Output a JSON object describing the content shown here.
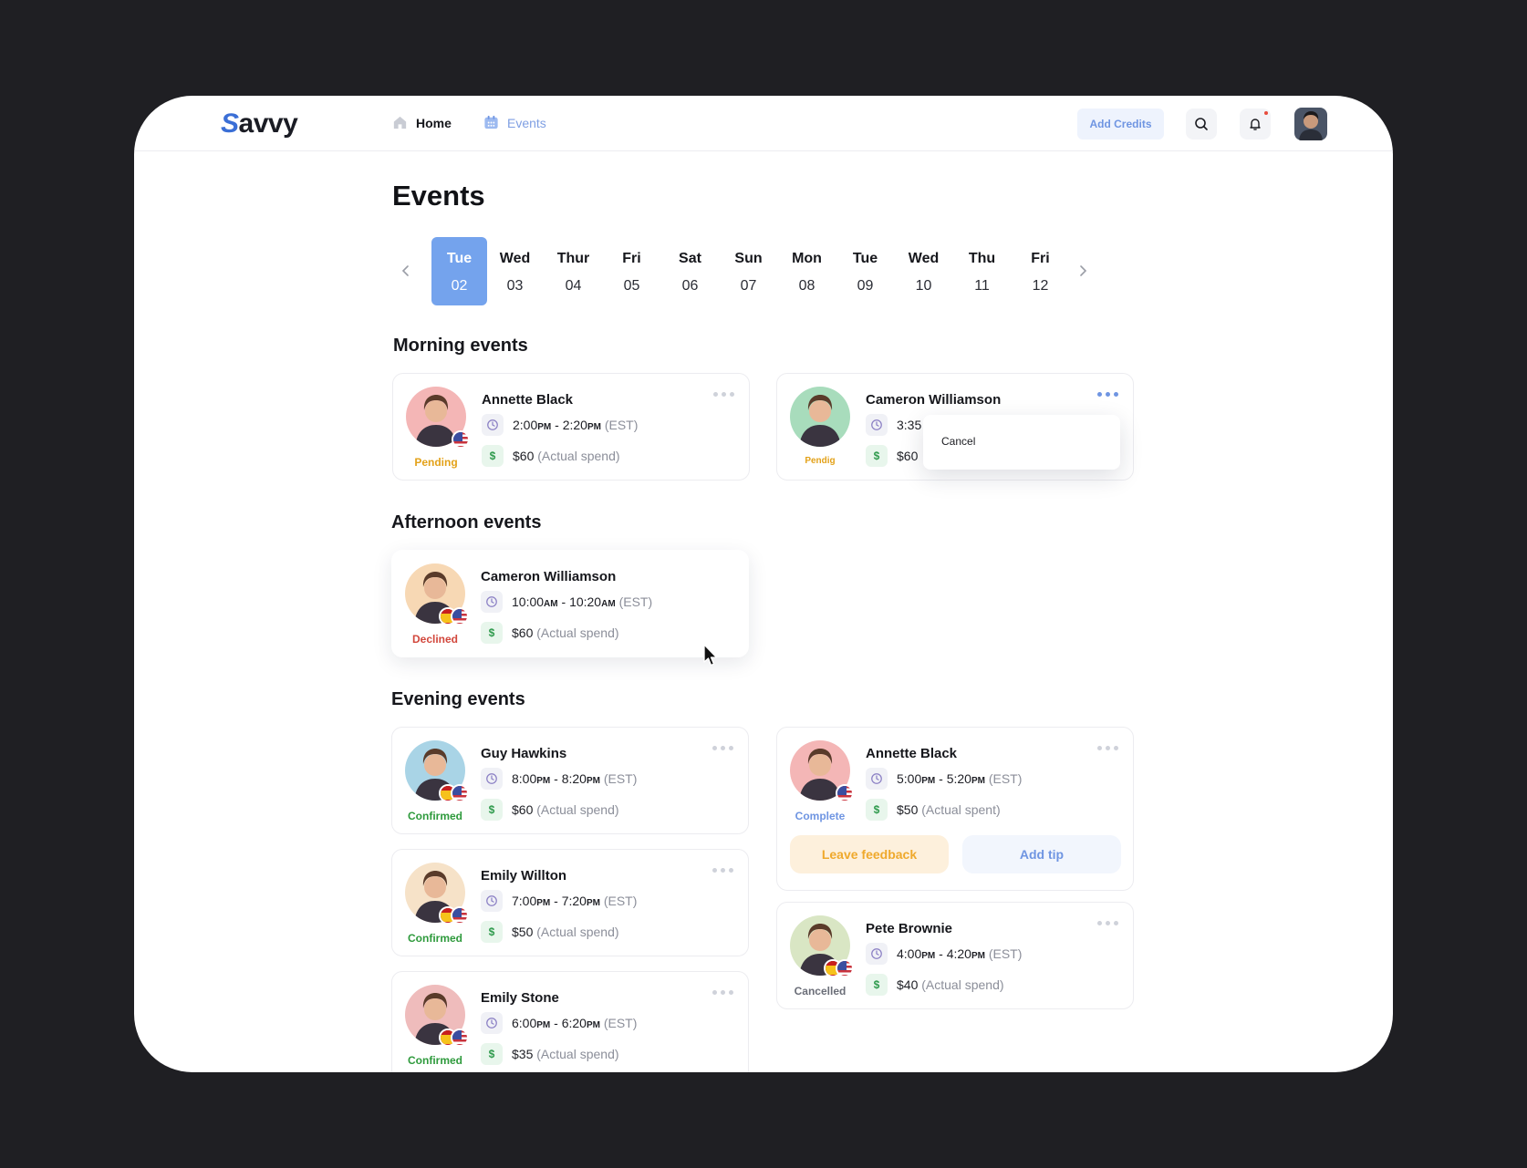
{
  "header": {
    "logo": "Savvy",
    "nav": [
      {
        "label": "Home",
        "icon": "home-icon"
      },
      {
        "label": "Events",
        "icon": "calendar-icon"
      }
    ],
    "add_credits": "Add Credits"
  },
  "page": {
    "title": "Events"
  },
  "dates": [
    {
      "day": "Tue",
      "date": "02",
      "active": true
    },
    {
      "day": "Wed",
      "date": "03"
    },
    {
      "day": "Thur",
      "date": "04"
    },
    {
      "day": "Fri",
      "date": "05"
    },
    {
      "day": "Sat",
      "date": "06"
    },
    {
      "day": "Sun",
      "date": "07"
    },
    {
      "day": "Mon",
      "date": "08"
    },
    {
      "day": "Tue",
      "date": "09"
    },
    {
      "day": "Wed",
      "date": "10"
    },
    {
      "day": "Thu",
      "date": "11"
    },
    {
      "day": "Fri",
      "date": "12"
    }
  ],
  "sections": {
    "morning": "Morning events",
    "afternoon": "Afternoon events",
    "evening": "Evening events"
  },
  "colors": {
    "accent": "#74a3ed",
    "pending": "#e3a21a",
    "declined": "#d2473c",
    "confirmed": "#2e9a3c",
    "complete": "#6f95e2",
    "cancelled": "#6b6e78"
  },
  "events": {
    "m1": {
      "name": "Annette Black",
      "start": "2:00",
      "start_ampm": "PM",
      "end": "2:20",
      "end_ampm": "PM",
      "tz": "(EST)",
      "amount": "$60",
      "amount_note": "(Actual spend)",
      "status": "Pending"
    },
    "m2": {
      "name": "Cameron Williamson",
      "start": "3:35",
      "amount": "$60",
      "status": "Pendig",
      "menu_item": "Cancel"
    },
    "a1": {
      "name": "Cameron Williamson",
      "start": "10:00",
      "start_ampm": "AM",
      "end": "10:20",
      "end_ampm": "AM",
      "tz": "(EST)",
      "amount": "$60",
      "amount_note": "(Actual spend)",
      "status": "Declined"
    },
    "e1": {
      "name": "Guy Hawkins",
      "start": "8:00",
      "start_ampm": "PM",
      "end": "8:20",
      "end_ampm": "PM",
      "tz": "(EST)",
      "amount": "$60",
      "amount_note": "(Actual spend)",
      "status": "Confirmed"
    },
    "e2": {
      "name": "Emily Willton",
      "start": "7:00",
      "start_ampm": "PM",
      "end": "7:20",
      "end_ampm": "PM",
      "tz": "(EST)",
      "amount": "$50",
      "amount_note": "(Actual spend)",
      "status": "Confirmed"
    },
    "e3": {
      "name": "Emily Stone",
      "start": "6:00",
      "start_ampm": "PM",
      "end": "6:20",
      "end_ampm": "PM",
      "tz": "(EST)",
      "amount": "$35",
      "amount_note": "(Actual spend)",
      "status": "Confirmed"
    },
    "e4": {
      "name": "Annette Black",
      "start": "5:00",
      "start_ampm": "PM",
      "end": "5:20",
      "end_ampm": "PM",
      "tz": "(EST)",
      "amount": "$50",
      "amount_note": "(Actual spent)",
      "status": "Complete",
      "feedback_label": "Leave feedback",
      "tip_label": "Add tip"
    },
    "e5": {
      "name": "Pete Brownie",
      "start": "4:00",
      "start_ampm": "PM",
      "end": "4:20",
      "end_ampm": "PM",
      "tz": "(EST)",
      "amount": "$40",
      "amount_note": "(Actual spend)",
      "status": "Cancelled"
    }
  }
}
